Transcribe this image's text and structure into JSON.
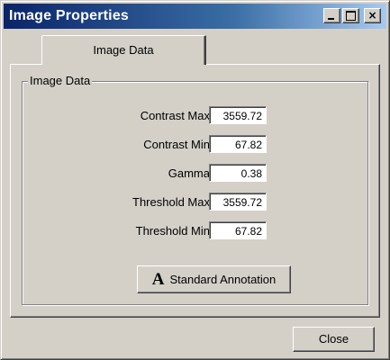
{
  "window": {
    "title": "Image Properties",
    "titlebar_gradient": [
      "#0a246a",
      "#a6caf0"
    ],
    "face_color": "#d4d0c8"
  },
  "titlebar_buttons": {
    "minimize_icon": "minimize-icon",
    "maximize_icon": "maximize-icon",
    "close_glyph": "×"
  },
  "tabs": [
    {
      "label": "Image Data",
      "selected": true
    }
  ],
  "group": {
    "legend": "Image Data"
  },
  "fields": [
    {
      "label": "Contrast Max",
      "value": "3559.72"
    },
    {
      "label": "Contrast Min",
      "value": "67.82"
    },
    {
      "label": "Gamma",
      "value": "0.38"
    },
    {
      "label": "Threshold Max",
      "value": "3559.72"
    },
    {
      "label": "Threshold Min",
      "value": "67.82"
    }
  ],
  "annotation_button": {
    "icon_glyph": "A",
    "label": "Standard Annotation"
  },
  "footer": {
    "close_label": "Close"
  }
}
